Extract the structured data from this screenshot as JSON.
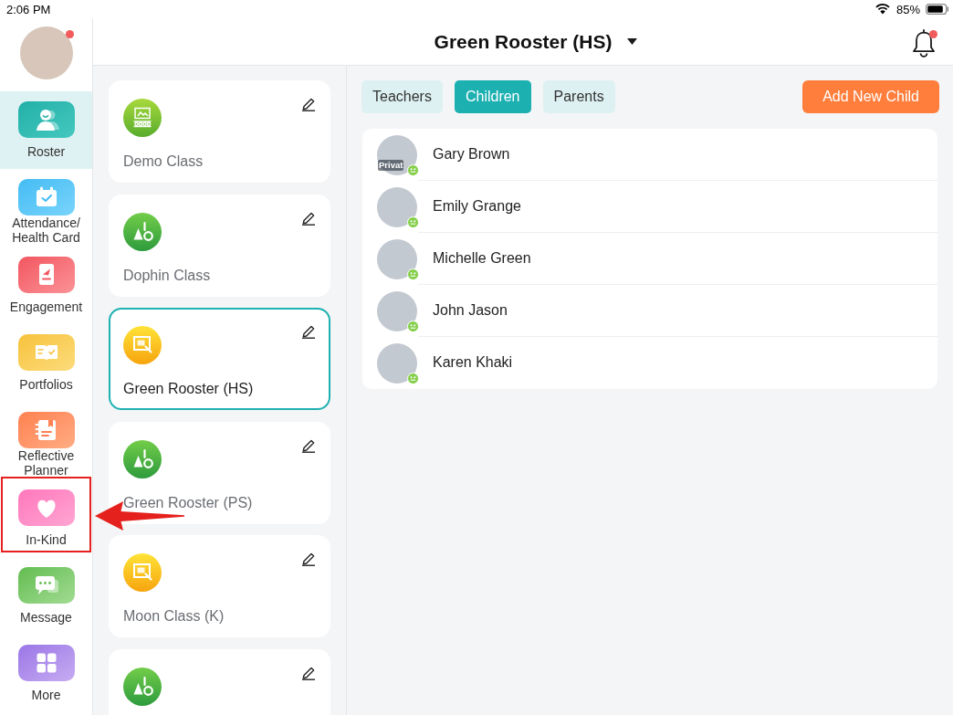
{
  "status_bar": {
    "time": "2:06 PM",
    "battery": "85%"
  },
  "sidebar": {
    "profile": {
      "unread": true
    },
    "items": [
      {
        "kind": "roster",
        "label": "Roster",
        "selected": true,
        "annotated": false
      },
      {
        "kind": "attendance",
        "label": "Attendance/Health Card",
        "selected": false,
        "annotated": false
      },
      {
        "kind": "engagement",
        "label": "Engagement",
        "selected": false,
        "annotated": false
      },
      {
        "kind": "portfolios",
        "label": "Portfolios",
        "selected": false,
        "annotated": false
      },
      {
        "kind": "planner",
        "label": "Reflective Planner",
        "selected": false,
        "annotated": false
      },
      {
        "kind": "inkind",
        "label": "In-Kind",
        "selected": false,
        "annotated": true
      },
      {
        "kind": "message",
        "label": "Message",
        "selected": false,
        "annotated": false
      },
      {
        "kind": "more",
        "label": "More",
        "selected": false,
        "annotated": false
      }
    ]
  },
  "header": {
    "title": "Green Rooster (HS)",
    "unread": true
  },
  "classes": [
    {
      "kind": "board",
      "name": "Demo Class",
      "selected": false
    },
    {
      "kind": "letters",
      "name": "Dophin Class",
      "selected": false
    },
    {
      "kind": "frame",
      "name": "Green Rooster (HS)",
      "selected": true
    },
    {
      "kind": "letters",
      "name": "Green Rooster (PS)",
      "selected": false
    },
    {
      "kind": "frame",
      "name": "Moon Class (K)",
      "selected": false
    },
    {
      "kind": "letters",
      "selected": false
    }
  ],
  "tabs": [
    {
      "label": "Teachers",
      "selected": false
    },
    {
      "label": "Children",
      "selected": true
    },
    {
      "label": "Parents",
      "selected": false
    }
  ],
  "add_button": "Add New Child",
  "children": [
    {
      "name": "Gary Brown",
      "badge": "Privat"
    },
    {
      "name": "Emily Grange"
    },
    {
      "name": "Michelle Green"
    },
    {
      "name": "John Jason"
    },
    {
      "name": "Karen Khaki"
    }
  ]
}
